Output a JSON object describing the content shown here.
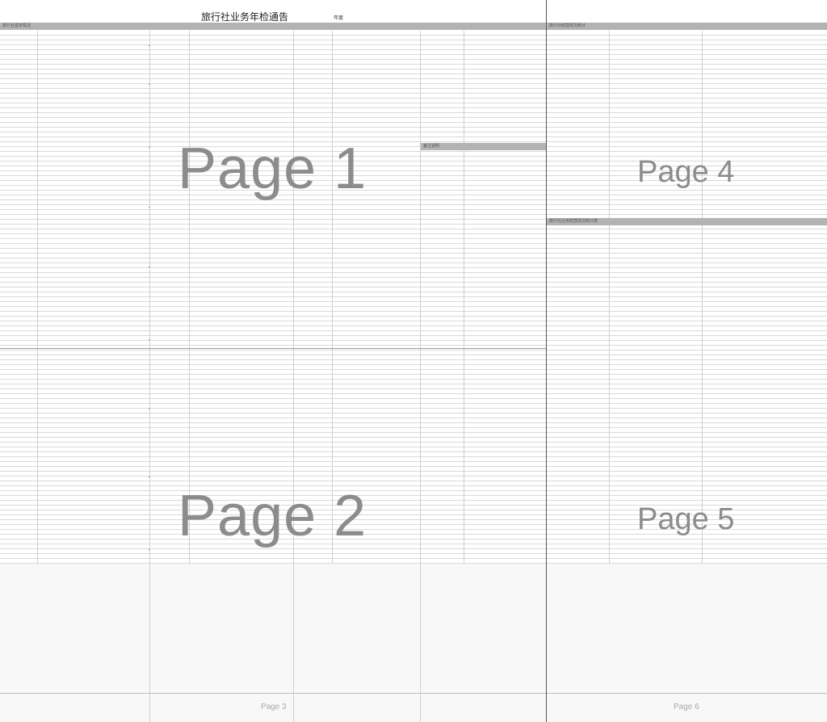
{
  "document": {
    "title": "旅行社业务年检通告",
    "title_suffix": "年度"
  },
  "sections": {
    "left_band_label": "旅行社基本情况",
    "mid_band_label": "备注说明",
    "right_band_top_label": "旅行社经营情况统计",
    "right_band_mid_label": "旅行社业务经营情况统计表"
  },
  "page_watermarks": {
    "page1": "Page 1",
    "page2": "Page 2",
    "page3": "Page 3",
    "page4": "Page 4",
    "page5": "Page 5",
    "page6": "Page 6"
  },
  "colors": {
    "band": "#b3b3b3",
    "watermark": "#8c8c8c",
    "page_divider": "#555555"
  }
}
